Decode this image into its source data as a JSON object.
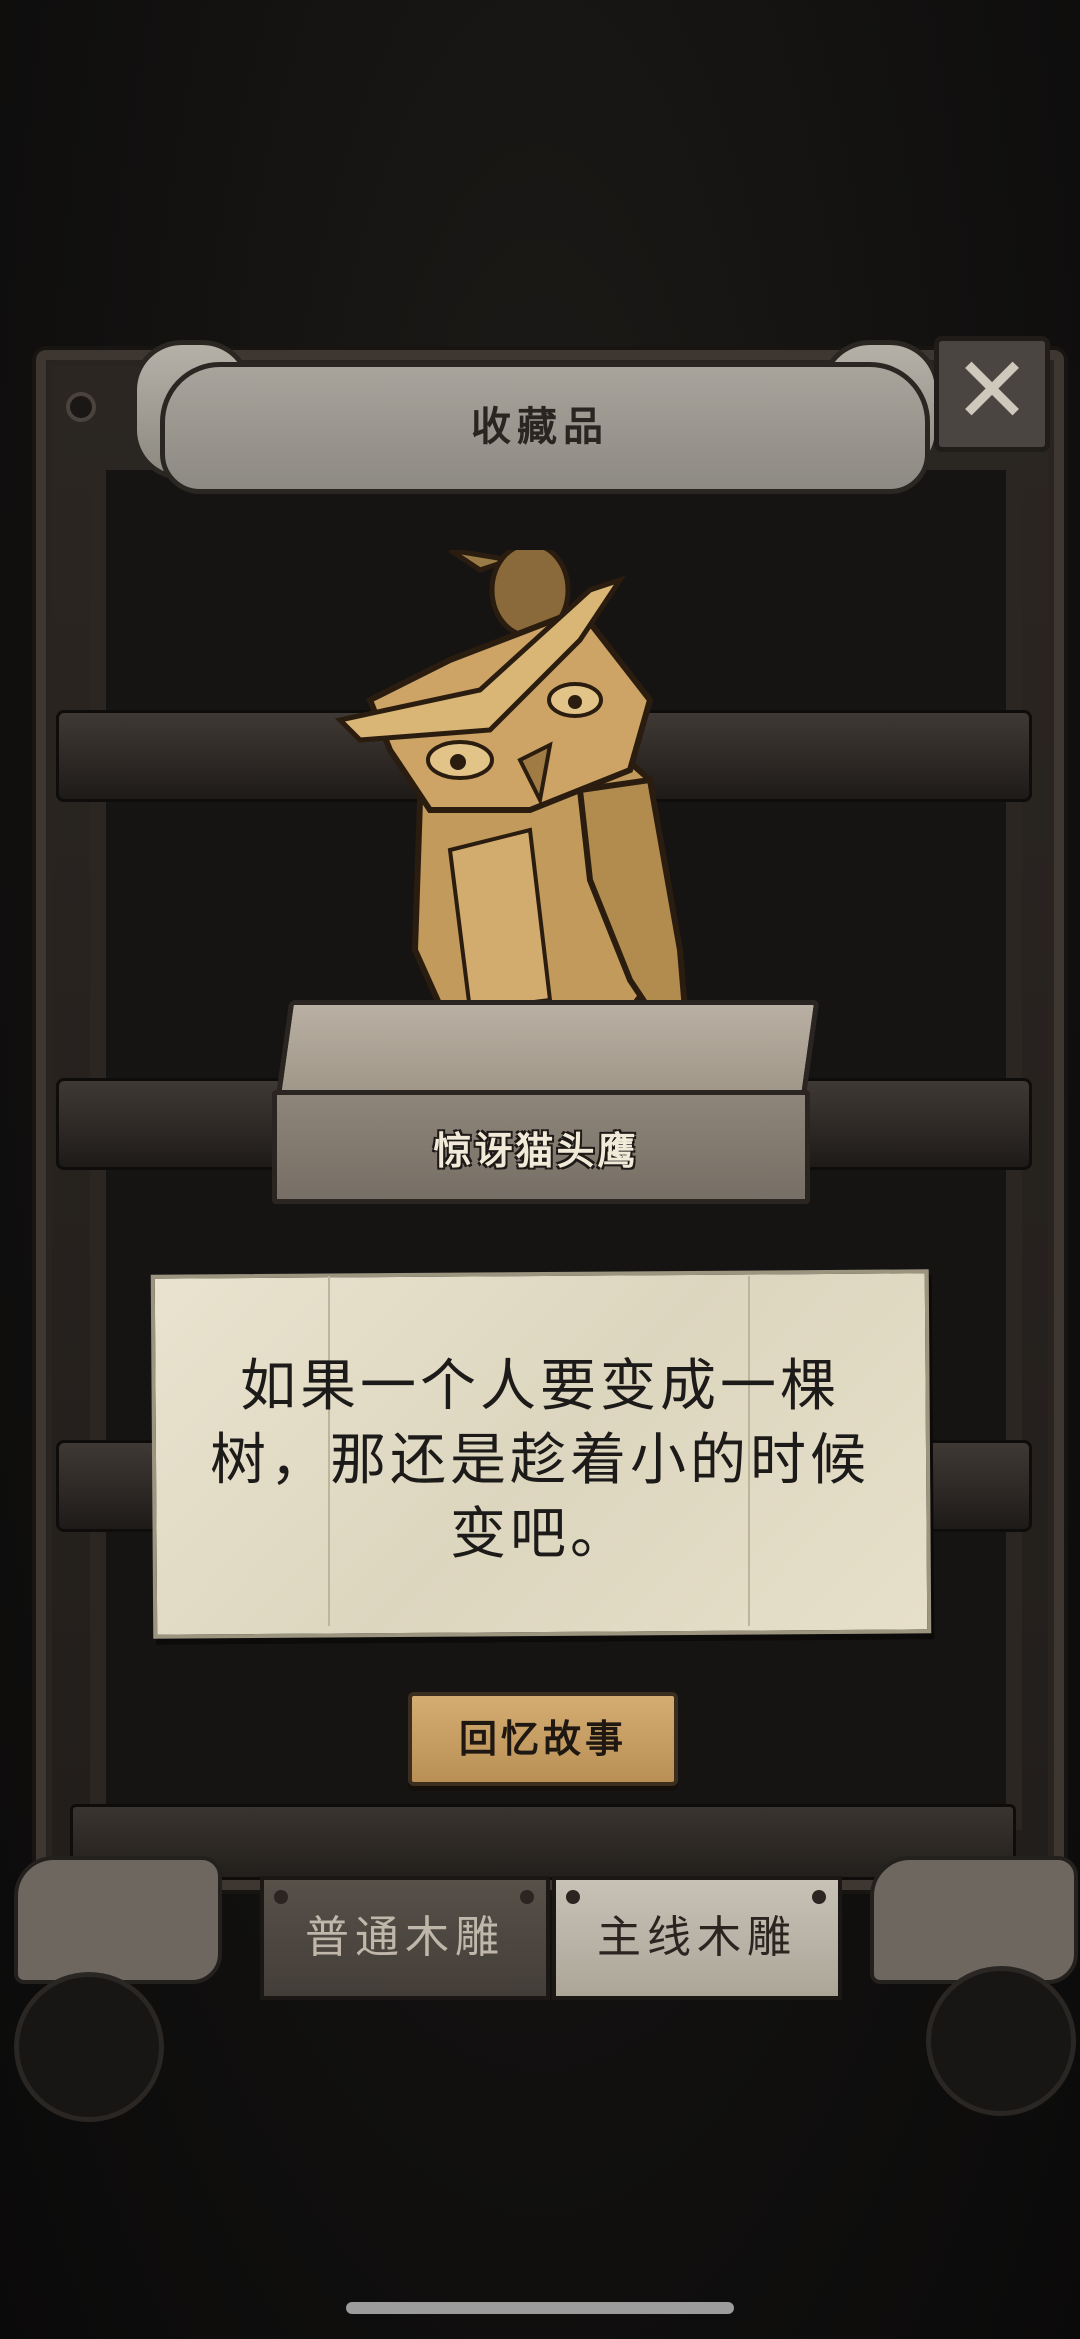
{
  "banner": {
    "title": "收藏品"
  },
  "close_icon": "close-x-icon",
  "item": {
    "name": "惊讶猫头鹰",
    "image": "wooden-owl-carving"
  },
  "note": {
    "text": "如果一个人要变成一棵树，那还是趁着小的时候变吧。"
  },
  "recall_button": {
    "label": "回忆故事"
  },
  "tabs": [
    {
      "label": "普通木雕",
      "selected": false
    },
    {
      "label": "主线木雕",
      "selected": true
    }
  ],
  "colors": {
    "paper": "#e9e3cf",
    "wood_button": "#d4ad72",
    "cabinet": "#2b2622"
  }
}
